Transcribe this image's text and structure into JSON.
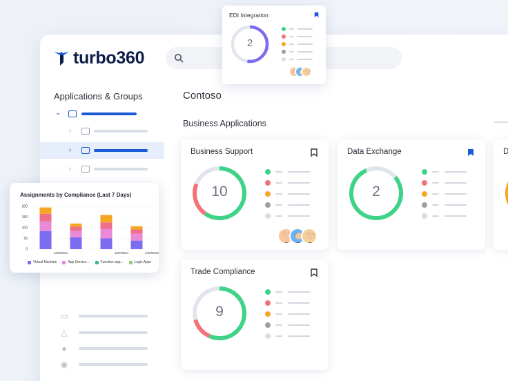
{
  "brand": {
    "name": "turbo360",
    "color": "#0c1d4a",
    "accent": "#1a5ad6"
  },
  "search": {
    "icon": "search-icon"
  },
  "sidebar": {
    "title": "Applications & Groups",
    "bottom_icons": [
      "monitor-icon",
      "triangle-icon",
      "user-icon",
      "users-icon"
    ]
  },
  "main": {
    "title": "Contoso",
    "section": "Business Applications"
  },
  "legend_colors": [
    "#3fd389",
    "#f2727a",
    "#f5a623",
    "#9aa0a6",
    "#d8dde6"
  ],
  "cards": [
    {
      "id": "business-support",
      "title": "Business Support",
      "count": "10",
      "bookmarked": false
    },
    {
      "id": "data-exchange",
      "title": "Data Exchange",
      "count": "2",
      "bookmarked": true
    },
    {
      "id": "partial",
      "title": "D",
      "count": "",
      "bookmarked": false
    },
    {
      "id": "trade-compliance",
      "title": "Trade Compliance",
      "count": "9",
      "bookmarked": false
    }
  ],
  "edi_card": {
    "title": "EDI Integration",
    "count": "2",
    "bookmarked": true
  },
  "compliance_chart": {
    "title": "Assignments by Compliance (Last 7 Days)",
    "chart_data": {
      "type": "bar",
      "title": "Assignments by Compliance (Last 7 Days)",
      "stacked": true,
      "categories": [
        "1/28/2024",
        "",
        "1/27/2024",
        "1/26/2024"
      ],
      "yticks": [
        0,
        50,
        100,
        150,
        200
      ],
      "ylim": [
        0,
        200
      ],
      "series": [
        {
          "name": "Virtual Machine",
          "color": "#7b6cf0",
          "values": [
            85,
            55,
            50,
            40
          ]
        },
        {
          "name": "App Service...",
          "color": "#e98ad8",
          "values": [
            45,
            30,
            45,
            32
          ]
        },
        {
          "name": "Function app...",
          "color": "#ef6e8a",
          "values": [
            35,
            20,
            30,
            20
          ]
        },
        {
          "name": "Logic Apps",
          "color": "#f5a623",
          "values": [
            30,
            15,
            35,
            15
          ]
        }
      ],
      "legend": [
        {
          "name": "Virtual Machine",
          "color": "#7b6cf0"
        },
        {
          "name": "App Service...",
          "color": "#e98ad8"
        },
        {
          "name": "Function app...",
          "color": "#3fb88a"
        },
        {
          "name": "Logic Apps",
          "color": "#8fd07a"
        }
      ]
    }
  }
}
